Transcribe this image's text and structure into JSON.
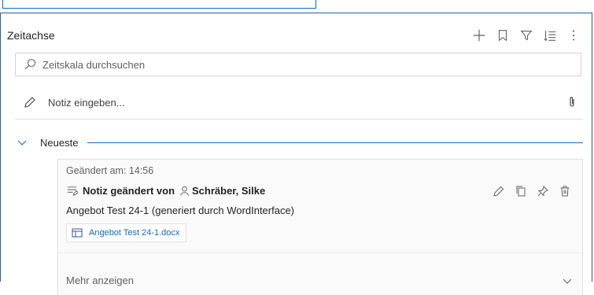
{
  "timeline": {
    "title": "Zeitachse",
    "search_placeholder": "Zeitskala durchsuchen",
    "note_placeholder": "Notiz eingeben...",
    "section_label": "Neueste",
    "toolbar": {
      "add_icon": "plus-icon",
      "bookmark_icon": "bookmark-icon",
      "filter_icon": "filter-icon",
      "sort_icon": "sort-icon",
      "more_icon": "more-vertical-icon"
    }
  },
  "entry": {
    "modified": "Geändert am: 14:56",
    "action_label": "Notiz geändert von",
    "author": "Schräber, Silke",
    "description": "Angebot Test 24-1 (generiert durch WordInterface)",
    "attachment": "Angebot Test 24-1.docx",
    "more_label": "Mehr anzeigen"
  },
  "colors": {
    "accent": "#0f6cbd",
    "border": "#2b5c9a",
    "muted_text": "#616161"
  }
}
